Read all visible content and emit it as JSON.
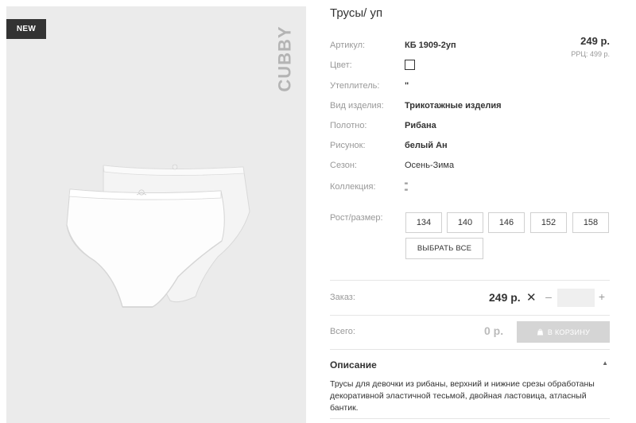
{
  "badge": {
    "new": "NEW"
  },
  "brand": {
    "logo_text": "CUBBY"
  },
  "product": {
    "title": "Трусы/ уп",
    "price": "249 р.",
    "rrp": "РРЦ: 499 р."
  },
  "attributes": [
    {
      "label": "Артикул:",
      "value": "КБ 1909-2уп"
    },
    {
      "label": "Цвет:",
      "value": ""
    },
    {
      "label": "Утеплитель:",
      "value": "\""
    },
    {
      "label": "Вид изделия:",
      "value": "Трикотажные изделия"
    },
    {
      "label": "Полотно:",
      "value": "Рибана"
    },
    {
      "label": "Рисунок:",
      "value": "белый Ан"
    },
    {
      "label": "Сезон:",
      "value": "Осень-Зима"
    },
    {
      "label": "Коллекция:",
      "value": "\"\n\""
    }
  ],
  "sizes": {
    "label": "Рост/размер:",
    "options": [
      "134",
      "140",
      "146",
      "152",
      "158"
    ],
    "select_all": "ВЫБРАТЬ ВСЕ"
  },
  "order": {
    "label": "Заказ:",
    "price": "249 р.",
    "times": "✕",
    "minus": "–",
    "plus": "+",
    "quantity": ""
  },
  "total": {
    "label": "Всего:",
    "value": "0 р.",
    "cart_button": "В КОРЗИНУ"
  },
  "description": {
    "title": "Описание",
    "text": "Трусы для девочки из рибаны, верхний и нижние срезы обработаны декоративной эластичной тесьмой, двойная ластовица, атласный бантик."
  },
  "icons": {
    "cart": "shopping-bag-icon",
    "collapse": "caret-up-icon"
  }
}
